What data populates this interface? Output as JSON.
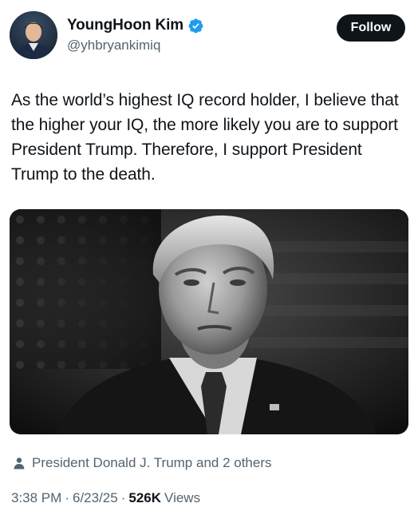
{
  "author": {
    "display_name": "YoungHoon Kim",
    "handle": "@yhbryankimiq",
    "verified": true,
    "avatar_icon": "profile-photo"
  },
  "follow_label": "Follow",
  "tweet": {
    "text": "As the world’s highest IQ record holder, I believe that the higher your IQ, the more likely you are to support President Trump. Therefore, I support President Trump to the death."
  },
  "media": {
    "type": "photo",
    "style": "black-and-white"
  },
  "social_context": {
    "icon": "person-icon",
    "text": "President Donald J. Trump and 2 others"
  },
  "meta": {
    "time": "3:38 PM",
    "separator": "·",
    "date": "6/23/25",
    "views_count": "526K",
    "views_label": "Views"
  },
  "colors": {
    "text_primary": "#0f1419",
    "text_secondary": "#536471",
    "verified_blue": "#1d9bf0",
    "follow_bg": "#0f1419"
  }
}
